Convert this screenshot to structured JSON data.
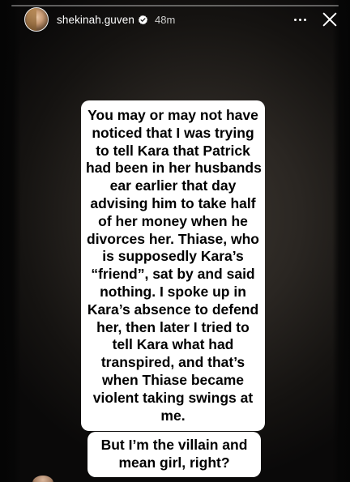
{
  "story": {
    "progress": 0.0,
    "author": {
      "username": "shekinah.guven",
      "verified": true,
      "posted_ago": "48m"
    },
    "icons": {
      "verified": "verified-badge-icon",
      "more": "more-options-icon",
      "close": "close-icon"
    },
    "main_text_lines": [
      "You may or may not have",
      "noticed that I was trying",
      "to tell Kara that Patrick",
      "had been in her husbands",
      "ear earlier that day",
      "advising him to take half",
      "of her money when he",
      "divorces her. Thiase, who",
      "is supposedly Kara’s",
      "“friend”, sat by and said",
      "nothing. I spoke up in",
      "Kara’s absence to defend",
      "her, then later I tried to",
      "tell Kara what had",
      "transpired, and that’s",
      "when Thiase became",
      "violent taking swings at",
      "me."
    ],
    "tail_text_lines": [
      "But I’m the villain and",
      "mean girl, right?"
    ]
  },
  "colors": {
    "sticker_background": "#ffffff",
    "sticker_text": "#000000",
    "header_text": "#ffffff"
  }
}
